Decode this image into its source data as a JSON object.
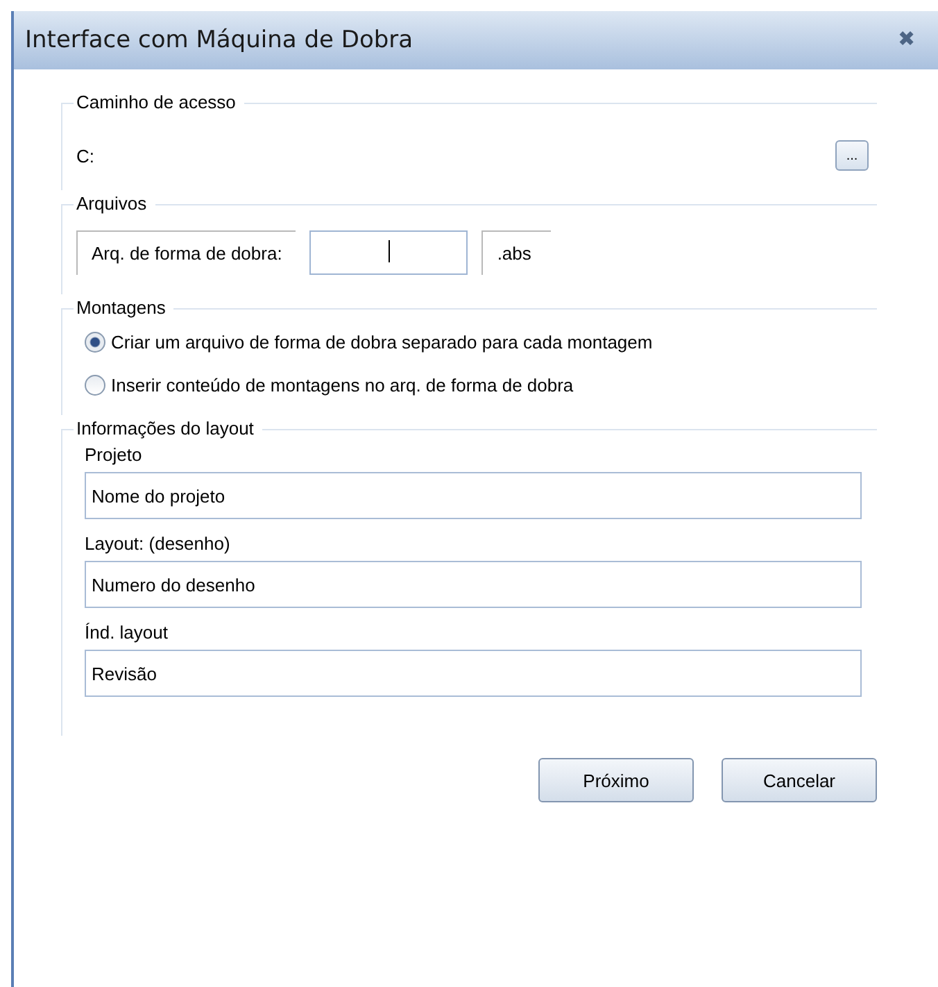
{
  "window": {
    "title": "Interface com Máquina de Dobra",
    "close": "✖"
  },
  "path_group": {
    "title": "Caminho de acesso",
    "path": "C:",
    "browse_label": "..."
  },
  "files_group": {
    "title": "Arquivos",
    "label": "Arq. de forma de dobra:",
    "extension": ".abs"
  },
  "assemblies_group": {
    "title": "Montagens",
    "options": [
      {
        "label": "Criar um arquivo de forma de dobra separado para cada montagem",
        "selected": true
      },
      {
        "label": "Inserir conteúdo de montagens no arq. de forma de dobra",
        "selected": false
      }
    ]
  },
  "layout_group": {
    "title": "Informações do layout",
    "fields": [
      {
        "label": "Projeto",
        "value": "Nome do projeto"
      },
      {
        "label": "Layout: (desenho)",
        "value": "Numero do desenho"
      },
      {
        "label": "Índ. layout",
        "value": "Revisão"
      }
    ]
  },
  "buttons": [
    "Próximo",
    "Cancelar"
  ]
}
